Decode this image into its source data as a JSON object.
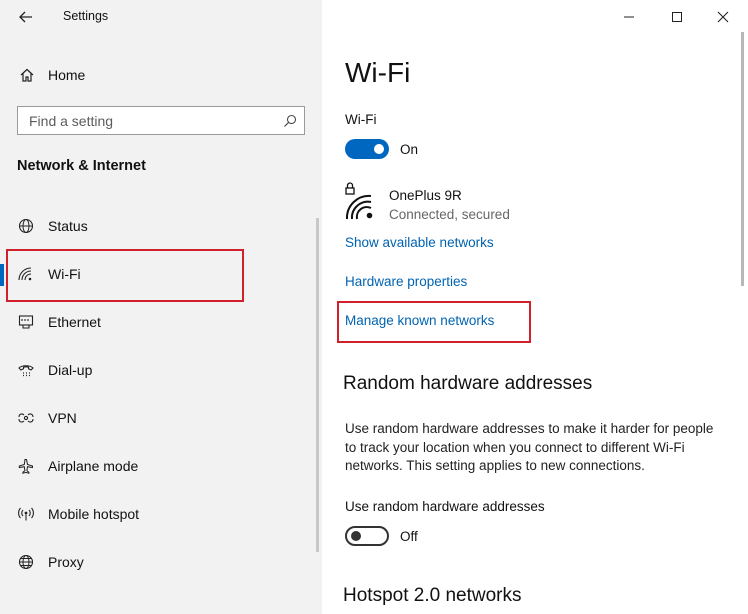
{
  "window": {
    "app_title": "Settings",
    "back_icon": "back-arrow-icon",
    "controls": [
      "minimize-icon",
      "maximize-icon",
      "close-icon"
    ]
  },
  "sidebar": {
    "home_label": "Home",
    "search_placeholder": "Find a setting",
    "section_title": "Network & Internet",
    "items": [
      {
        "label": "Status",
        "icon": "status-globe-icon"
      },
      {
        "label": "Wi-Fi",
        "icon": "wifi-icon",
        "active": true
      },
      {
        "label": "Ethernet",
        "icon": "ethernet-icon"
      },
      {
        "label": "Dial-up",
        "icon": "dialup-phone-icon"
      },
      {
        "label": "VPN",
        "icon": "vpn-icon"
      },
      {
        "label": "Airplane mode",
        "icon": "airplane-icon"
      },
      {
        "label": "Mobile hotspot",
        "icon": "hotspot-icon"
      },
      {
        "label": "Proxy",
        "icon": "proxy-globe-icon"
      }
    ]
  },
  "main": {
    "title": "Wi-Fi",
    "wifi_label": "Wi-Fi",
    "wifi_state": "On",
    "network": {
      "name": "OnePlus 9R",
      "status": "Connected, secured"
    },
    "links": {
      "show_available": "Show available networks",
      "hardware_properties": "Hardware properties",
      "manage_known": "Manage known networks"
    },
    "random_hw": {
      "heading": "Random hardware addresses",
      "description": "Use random hardware addresses to make it harder for people to track your location when you connect to different Wi-Fi networks. This setting applies to new connections.",
      "toggle_label": "Use random hardware addresses",
      "toggle_state": "Off"
    },
    "hotspot_heading": "Hotspot 2.0 networks"
  },
  "colors": {
    "accent": "#0067c0",
    "link": "#0063b1",
    "highlight_box": "#d0202c",
    "sidebar_bg": "#f2f2f2"
  }
}
